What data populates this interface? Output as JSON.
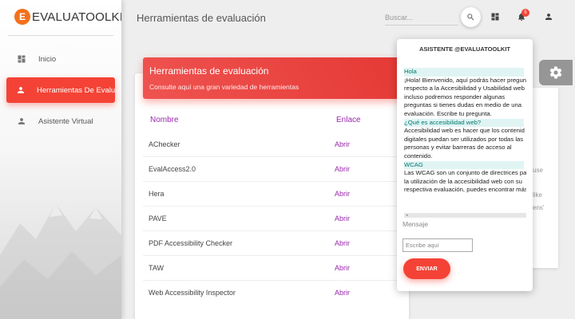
{
  "app": {
    "logo_letter": "E",
    "logo_text": "EVALUATOOLKIT",
    "accent_color": "#f44336",
    "link_color": "#9c27b0"
  },
  "sidebar": {
    "items": [
      {
        "label": "Inicio",
        "icon": "dashboard-icon"
      },
      {
        "label": "Herramientas De Evaluación",
        "icon": "person-icon"
      },
      {
        "label": "Asistente Virtual",
        "icon": "person-icon"
      }
    ]
  },
  "header": {
    "title": "Herramientas de evaluación",
    "search_placeholder": "Buscar...",
    "notification_count": "5"
  },
  "main": {
    "card_title": "Herramientas de evaluación",
    "card_subtitle": "Consulte aquí una gran variedad de herramientas",
    "columns": [
      "Nombre",
      "Enlace"
    ],
    "rows": [
      {
        "name": "AChecker",
        "link": "Abrir"
      },
      {
        "name": "EvalAccess2.0",
        "link": "Abrir"
      },
      {
        "name": "Hera",
        "link": "Abrir"
      },
      {
        "name": "PAVE",
        "link": "Abrir"
      },
      {
        "name": "PDF Accessibility Checker",
        "link": "Abrir"
      },
      {
        "name": "TAW",
        "link": "Abrir"
      },
      {
        "name": "Web Accessibility Inspector",
        "link": "Abrir"
      }
    ]
  },
  "right_panel": {
    "fragments": [
      "use",
      "like",
      "ens'"
    ]
  },
  "chat": {
    "title": "ASISTENTE @EVALUATOOLKIT",
    "messages": [
      {
        "text": "Hola",
        "highlight": true
      },
      {
        "text": "¡Hola! Bienvenido, aquí podrás hacer pregunt",
        "highlight": false
      },
      {
        "text": "respecto a la Accesibilidad y Usabilidad web",
        "highlight": false
      },
      {
        "text": "incluso podremos responder algunas",
        "highlight": false
      },
      {
        "text": "preguntas si tienes dudas en medio de una",
        "highlight": false
      },
      {
        "text": "evaluación. Escribe tu pregunta.",
        "highlight": false
      },
      {
        "text": "¿Qué es accesibilidad web?",
        "highlight": true
      },
      {
        "text": "Accesibilidad web es hacer que los contenid",
        "highlight": false
      },
      {
        "text": "digitales puedan ser utilizados por todas las",
        "highlight": false
      },
      {
        "text": "personas y evitar barreras de acceso al",
        "highlight": false
      },
      {
        "text": "contenido.",
        "highlight": false
      },
      {
        "text": "WCAG",
        "highlight": true
      },
      {
        "text": "Las WCAG son un conjunto de directrices pa",
        "highlight": false
      },
      {
        "text": "la utilización de la accesibilidad web con su",
        "highlight": false
      },
      {
        "text": "respectiva evaluación, puedes encontrar más",
        "highlight": false
      }
    ],
    "scroll_marker": "◂",
    "input_label": "Mensaje",
    "input_placeholder": "Escribe aquí",
    "send_label": "ENVIAR"
  }
}
